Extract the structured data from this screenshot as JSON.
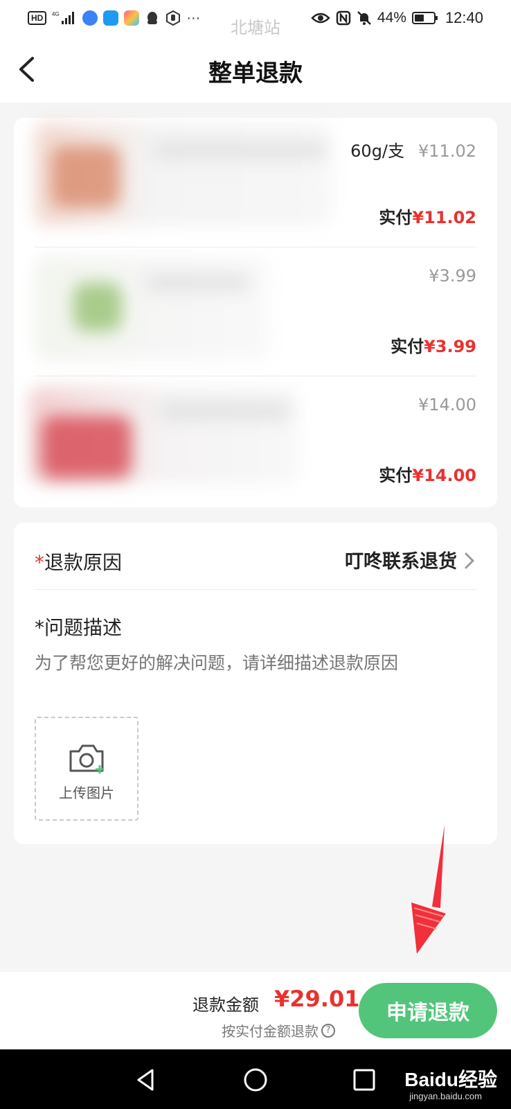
{
  "status_bar": {
    "battery": "44%",
    "time": "12:40",
    "station": "北塘站",
    "network_label": "4G"
  },
  "header": {
    "title": "整单退款",
    "back_icon": "chevron-left-icon"
  },
  "products": [
    {
      "spec": "60g/支",
      "price": "¥11.02",
      "paid_label": "实付",
      "paid_amount": "¥11.02",
      "thumb_color": "#d98a6c"
    },
    {
      "spec": "",
      "price": "¥3.99",
      "paid_label": "实付",
      "paid_amount": "¥3.99",
      "thumb_color": "#9cc47a"
    },
    {
      "spec": "",
      "price": "¥14.00",
      "paid_label": "实付",
      "paid_amount": "¥14.00",
      "thumb_color": "#d8505a"
    }
  ],
  "form": {
    "reason_required_mark": "*",
    "reason_label": "退款原因",
    "reason_value": "叮咚联系退货",
    "desc_label": "*问题描述",
    "desc_placeholder": "为了帮您更好的解决问题，请详细描述退款原因",
    "upload_label": "上传图片"
  },
  "footer": {
    "refund_label": "退款金额",
    "refund_amount": "¥29.01",
    "refund_note": "按实付金额退款",
    "apply_button": "申请退款"
  },
  "watermark": {
    "brand": "Baidu经验",
    "url": "jingyan.baidu.com"
  },
  "colors": {
    "accent_green": "#52c57b",
    "price_red": "#e8322f",
    "annotation_red": "#f0303a"
  }
}
